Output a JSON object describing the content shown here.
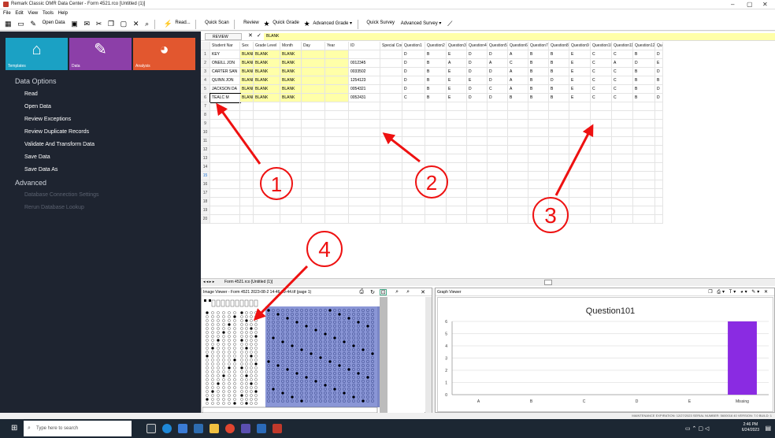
{
  "window": {
    "title": "Remark Classic OMR Data Center - Form 4521.rco [Untitled (1)]",
    "minimize": "–",
    "maximize": "▢",
    "close": "✕"
  },
  "menu": [
    "File",
    "Edit",
    "View",
    "Tools",
    "Help"
  ],
  "toolbar": {
    "open_data": "Open Data",
    "read": "Read...",
    "quick_scan": "Quick Scan",
    "review": "Review",
    "quick_grade": "Quick Grade",
    "advanced_grade": "Advanced Grade ▾",
    "quick_survey": "Quick Survey",
    "advanced_survey": "Advanced Survey ▾"
  },
  "tiles": [
    {
      "label": "Templates",
      "icon": "home-icon",
      "color": "#1ba1c4"
    },
    {
      "label": "Data",
      "icon": "pencil-icon",
      "color": "#8c3fa8"
    },
    {
      "label": "Analysis",
      "icon": "pie-chart-icon",
      "color": "#e2572f"
    }
  ],
  "nav": {
    "data_options_heading": "Data Options",
    "data_items": [
      "Read",
      "Open Data",
      "Review Exceptions",
      "Review Duplicate Records",
      "Validate And Transform Data",
      "Save Data",
      "Save Data As"
    ],
    "advanced_heading": "Advanced",
    "advanced_items": [
      "Database Connection Settings",
      "Rerun Database Lookup"
    ]
  },
  "formula_bar": {
    "review_label": "REVIEW",
    "value": "BLANK"
  },
  "grid": {
    "columns": [
      "Student Nar",
      "Sex",
      "Grade Level",
      "Month",
      "Day",
      "Year",
      "ID",
      "Special Cod",
      "Question1",
      "Question2",
      "Question3",
      "Question4",
      "Question5",
      "Question6",
      "Question7",
      "Question8",
      "Question9",
      "Question10",
      "Question11",
      "Question12",
      "Question13",
      "Qu"
    ],
    "row_numbers": [
      "1",
      "2",
      "3",
      "4",
      "5",
      "6",
      "7",
      "8",
      "9",
      "10",
      "11",
      "12",
      "13",
      "14",
      "15",
      "16",
      "17",
      "18",
      "19",
      "20"
    ],
    "rows": [
      [
        "KEY",
        "BLANK",
        "BLANK",
        "BLANK",
        "",
        "",
        "",
        "",
        "D",
        "B",
        "E",
        "D",
        "D",
        "A",
        "B",
        "B",
        "E",
        "C",
        "C",
        "B",
        "D",
        "D"
      ],
      [
        "ONEILL JON",
        "BLANK",
        "BLANK",
        "BLANK",
        "",
        "",
        "0012345",
        "",
        "D",
        "B",
        "A",
        "D",
        "A",
        "C",
        "B",
        "B",
        "E",
        "C",
        "A",
        "D",
        "E",
        "A"
      ],
      [
        "CARTER SAN",
        "BLANK",
        "BLANK",
        "BLANK",
        "",
        "",
        "0033502",
        "",
        "D",
        "B",
        "E",
        "D",
        "D",
        "A",
        "B",
        "B",
        "E",
        "C",
        "C",
        "B",
        "D",
        "D"
      ],
      [
        "QUINN JON",
        "BLANK",
        "BLANK",
        "BLANK",
        "",
        "",
        "1254123",
        "",
        "D",
        "B",
        "E",
        "E",
        "D",
        "A",
        "B",
        "D",
        "E",
        "C",
        "C",
        "B",
        "B",
        "D"
      ],
      [
        "JACKSON DA",
        "BLANK",
        "BLANK",
        "BLANK",
        "",
        "",
        "0054321",
        "",
        "D",
        "B",
        "E",
        "D",
        "C",
        "A",
        "B",
        "B",
        "E",
        "C",
        "C",
        "B",
        "D",
        "D"
      ],
      [
        "TEALC M",
        "BLANK",
        "BLANK",
        "BLANK",
        "",
        "",
        "0052431",
        "",
        "C",
        "B",
        "E",
        "D",
        "D",
        "B",
        "B",
        "B",
        "E",
        "C",
        "C",
        "B",
        "D",
        "E"
      ]
    ],
    "sheet_tab": "Form 4521.rco [Untitled (1)]"
  },
  "image_viewer": {
    "title": "Image Viewer - Form 4521 2023-08-2 14-46-09-44.tif (page 1)"
  },
  "graph_viewer": {
    "title": "Graph Viewer"
  },
  "chart_data": {
    "type": "bar",
    "title": "Question101",
    "categories": [
      "A",
      "B",
      "C",
      "D",
      "E",
      "Missing"
    ],
    "values": [
      0,
      0,
      0,
      0,
      0,
      6
    ],
    "ylim": [
      0,
      6
    ],
    "yticks": [
      "0",
      "1",
      "2",
      "3",
      "4",
      "5",
      "6"
    ],
    "bar_color": "#8a2be2"
  },
  "annotations": [
    "1",
    "2",
    "3",
    "4"
  ],
  "status": "MAINTENANCE EXPIRATION: 12/27/2023   SERIAL NUMBER: 5600016 40   VERSION: 7.0   BUILD: 1",
  "taskbar": {
    "search_placeholder": "Type here to search",
    "time": "2:46 PM",
    "date": "6/24/2023"
  }
}
